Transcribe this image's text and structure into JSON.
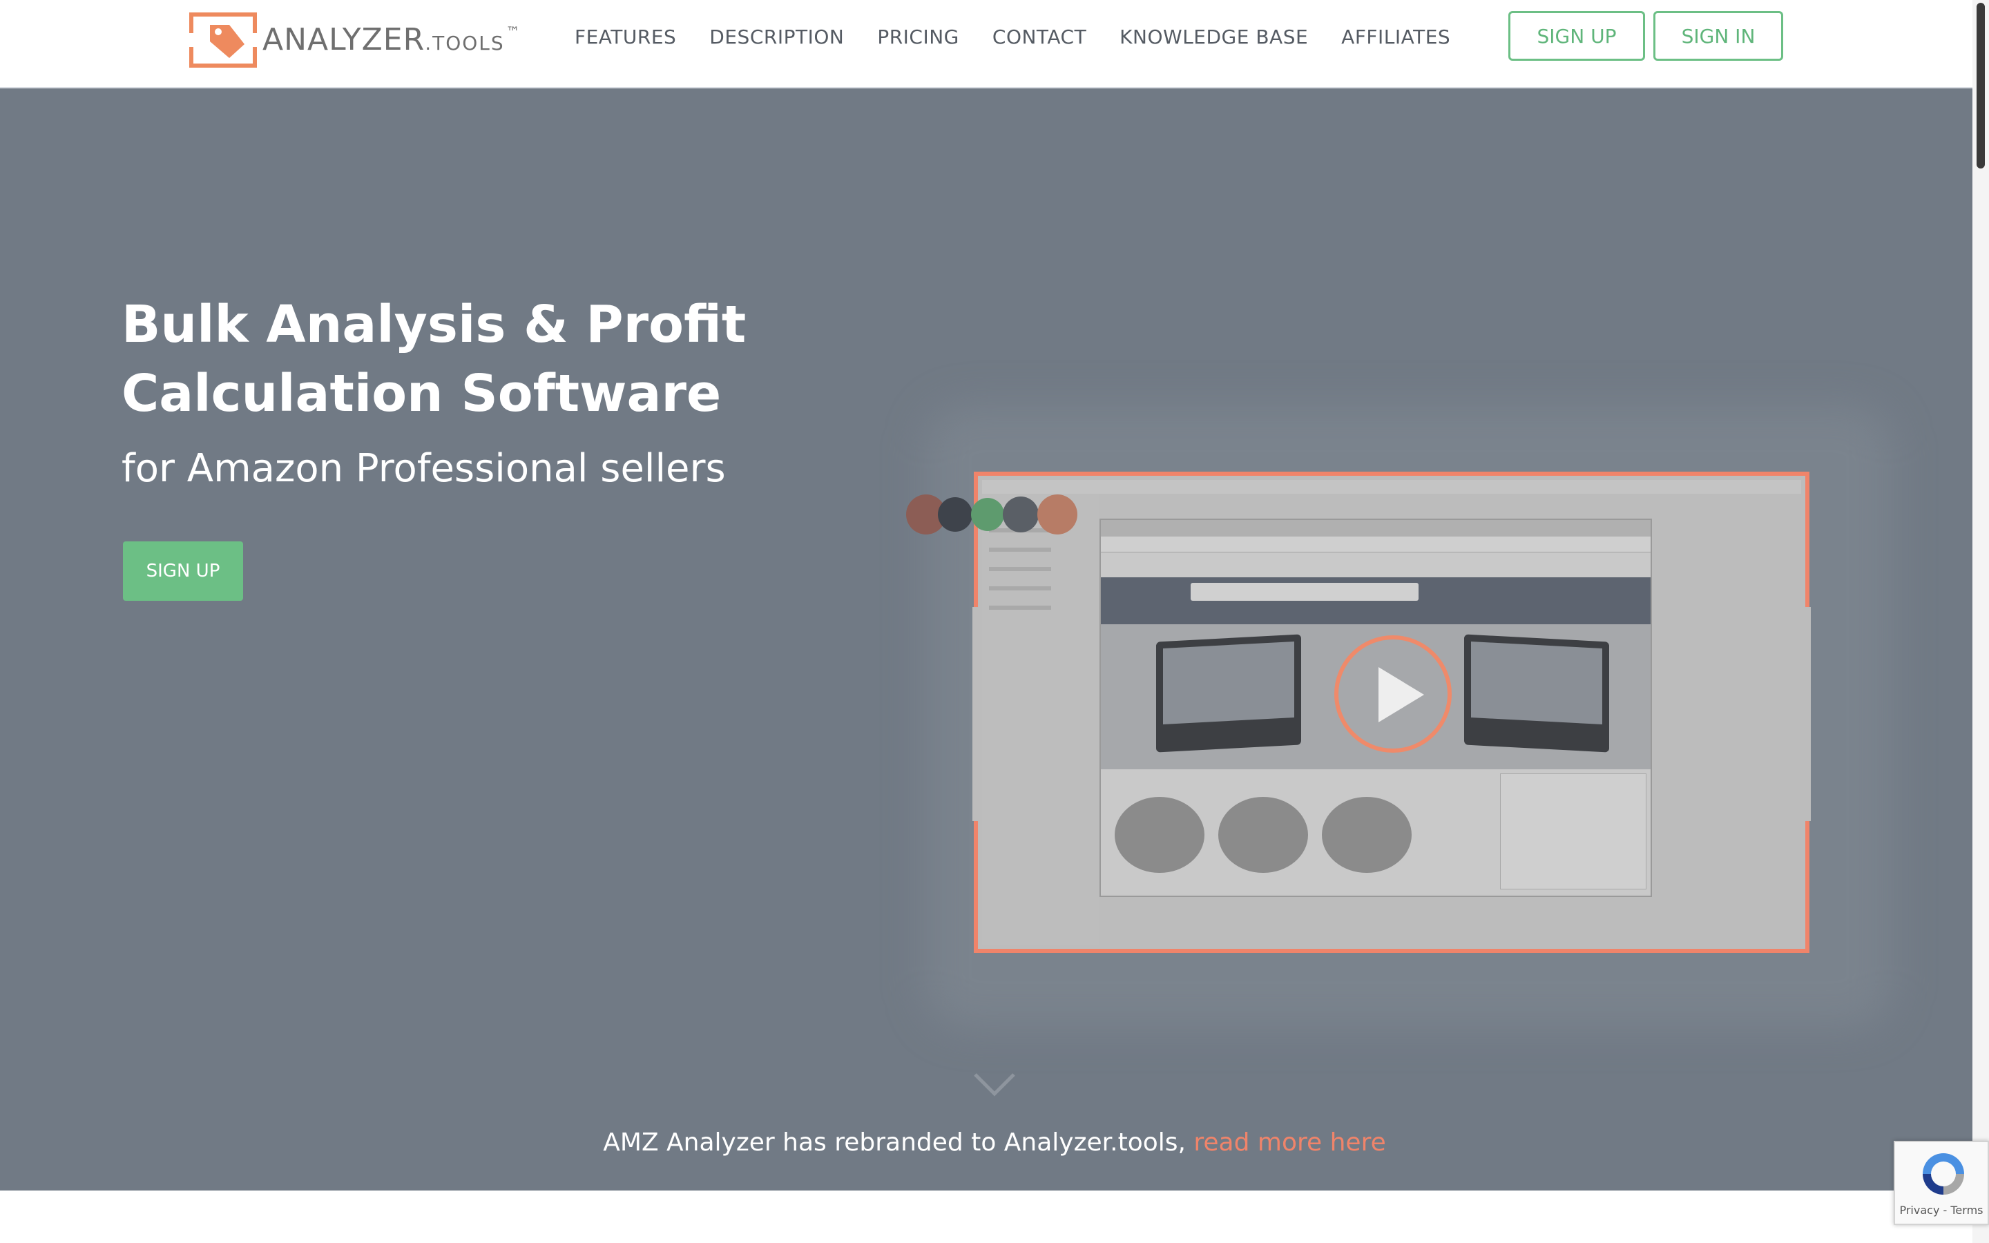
{
  "header": {
    "logo_text": "ANALYZER",
    "logo_tld": ".TOOLS",
    "logo_tm": "™",
    "nav": [
      "FEATURES",
      "DESCRIPTION",
      "PRICING",
      "CONTACT",
      "KNOWLEDGE BASE",
      "AFFILIATES"
    ],
    "sign_up": "SIGN UP",
    "sign_in": "SIGN IN"
  },
  "hero": {
    "title": "Bulk Analysis & Profit Calculation Software",
    "subtitle": "for Amazon Professional sellers",
    "signup_button": "SIGN UP",
    "video_icon": "play-icon",
    "scroll_icon": "chevron-down-icon"
  },
  "rebrand": {
    "text": "AMZ Analyzer has rebranded to Analyzer.tools, ",
    "link": "read more here"
  },
  "recaptcha": {
    "privacy": "Privacy",
    "separator": " - ",
    "terms": "Terms"
  },
  "colors": {
    "accent": "#f0846a",
    "green": "#6cbf85",
    "hero_overlay": "#717a85",
    "dots": [
      "#8c5d55",
      "#3e434b",
      "#5e9b6e",
      "#5a5f66",
      "#b77c66"
    ]
  }
}
